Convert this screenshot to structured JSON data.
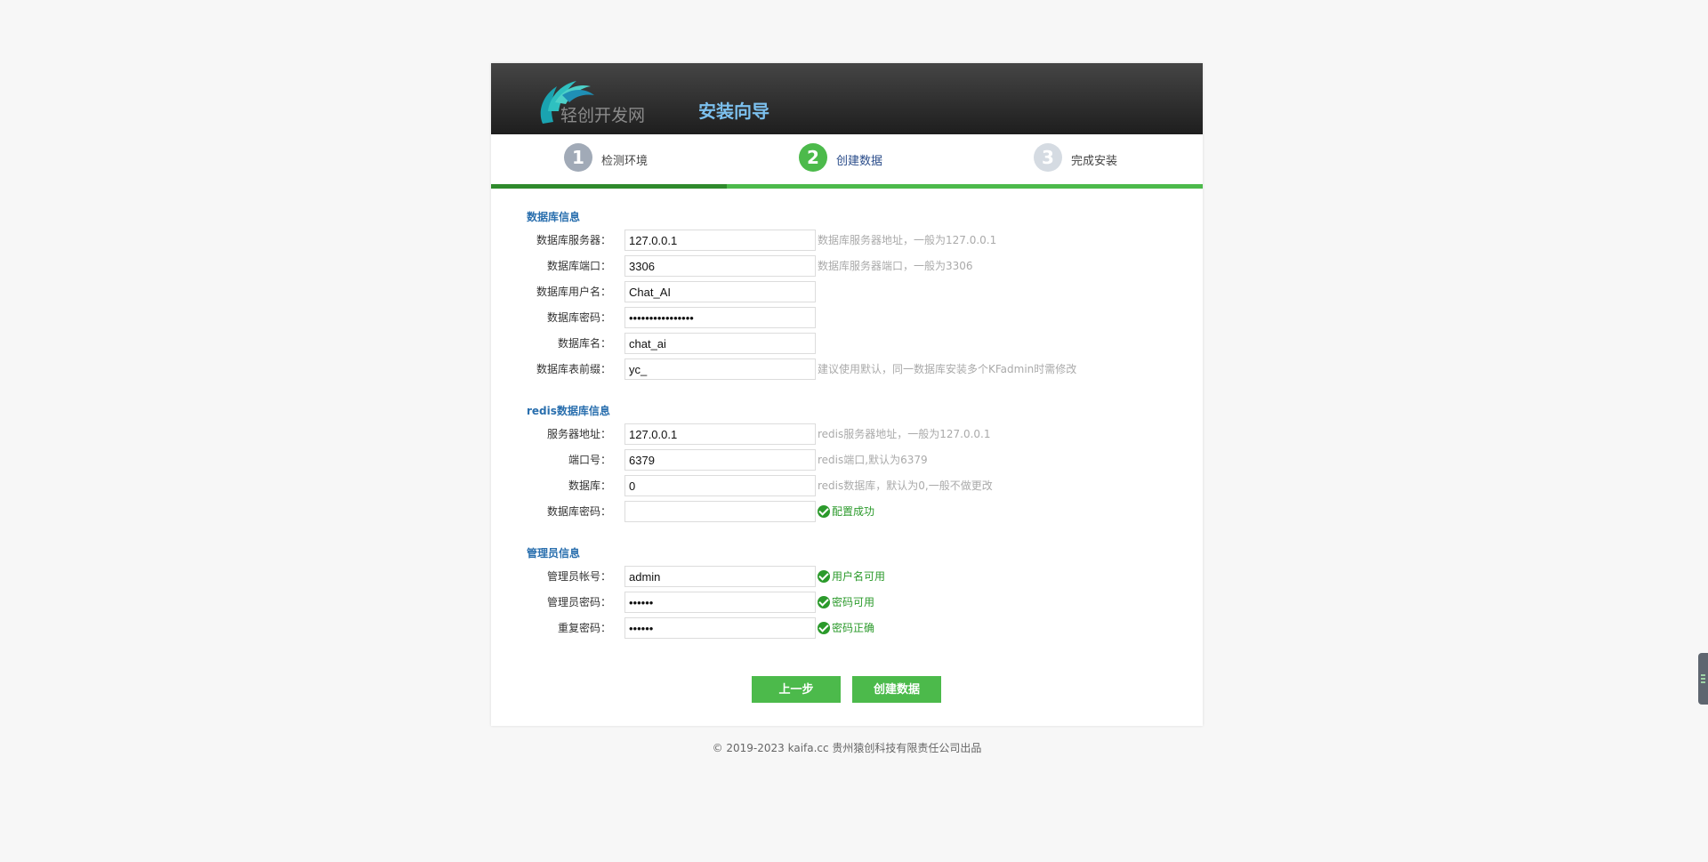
{
  "header": {
    "logo_text": "轻创开发网",
    "title": "安装向导"
  },
  "steps": [
    {
      "num": "1",
      "label": "检测环境"
    },
    {
      "num": "2",
      "label": "创建数据"
    },
    {
      "num": "3",
      "label": "完成安装"
    }
  ],
  "database": {
    "title": "数据库信息",
    "fields": [
      {
        "label": "数据库服务器：",
        "value": "127.0.0.1",
        "hint": "数据库服务器地址，一般为127.0.0.1"
      },
      {
        "label": "数据库端口：",
        "value": "3306",
        "hint": "数据库服务器端口，一般为3306"
      },
      {
        "label": "数据库用户名：",
        "value": "Chat_AI",
        "hint": ""
      },
      {
        "label": "数据库密码：",
        "value": "••••••••••••••••",
        "hint": ""
      },
      {
        "label": "数据库名：",
        "value": "chat_ai",
        "hint": ""
      },
      {
        "label": "数据库表前缀：",
        "value": "yc_",
        "hint": "建议使用默认，同一数据库安装多个KFadmin时需修改"
      }
    ]
  },
  "redis": {
    "title": "redis数据库信息",
    "fields": [
      {
        "label": "服务器地址：",
        "value": "127.0.0.1",
        "hint": "redis服务器地址，一般为127.0.0.1"
      },
      {
        "label": "端口号：",
        "value": "6379",
        "hint": "redis端口,默认为6379"
      },
      {
        "label": "数据库：",
        "value": "0",
        "hint": "redis数据库，默认为0,一般不做更改"
      },
      {
        "label": "数据库密码：",
        "value": "",
        "status": "配置成功"
      }
    ]
  },
  "admin": {
    "title": "管理员信息",
    "fields": [
      {
        "label": "管理员帐号：",
        "value": "admin",
        "status": "用户名可用"
      },
      {
        "label": "管理员密码：",
        "value": "••••••",
        "status": "密码可用"
      },
      {
        "label": "重复密码：",
        "value": "••••••",
        "status": "密码正确"
      }
    ]
  },
  "buttons": {
    "prev": "上一步",
    "create": "创建数据"
  },
  "footer": "© 2019-2023 kaifa.cc 贵州猿创科技有限责任公司出品",
  "colors": {
    "accent_green": "#4cba4b",
    "dark_green": "#2f8a2c",
    "section_blue": "#2a6fae",
    "header_title": "#7cc0ee"
  }
}
